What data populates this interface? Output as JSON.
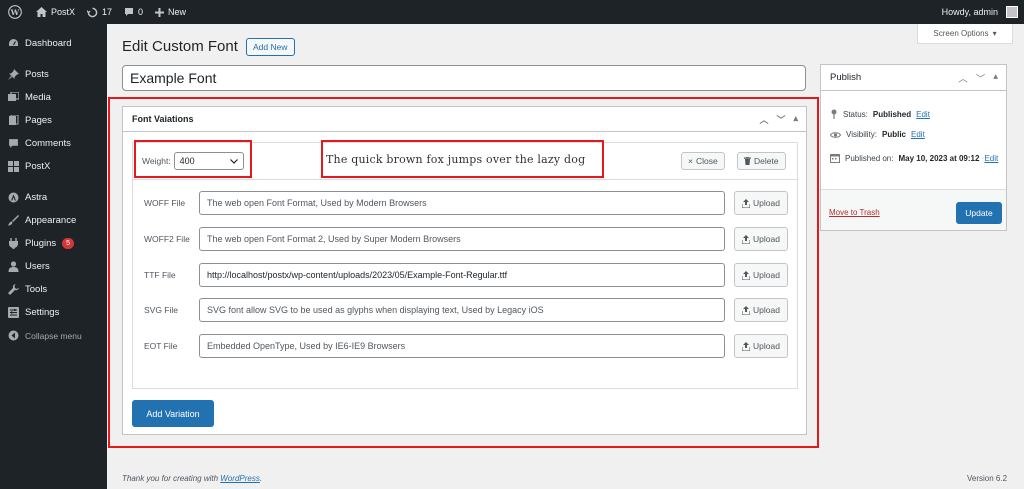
{
  "adminbar": {
    "site_name": "PostX",
    "updates_count": "17",
    "comments_count": "0",
    "new_label": "New",
    "howdy": "Howdy, admin"
  },
  "sidebar": {
    "items": [
      {
        "label": "Dashboard",
        "icon": "dashboard-icon"
      },
      {
        "label": "Posts",
        "icon": "pin-icon"
      },
      {
        "label": "Media",
        "icon": "media-icon"
      },
      {
        "label": "Pages",
        "icon": "page-icon"
      },
      {
        "label": "Comments",
        "icon": "comment-icon"
      },
      {
        "label": "PostX",
        "icon": "grid-icon"
      },
      {
        "label": "Astra",
        "icon": "astra-icon"
      },
      {
        "label": "Appearance",
        "icon": "brush-icon"
      },
      {
        "label": "Plugins",
        "icon": "plug-icon",
        "badge": "5"
      },
      {
        "label": "Users",
        "icon": "user-icon"
      },
      {
        "label": "Tools",
        "icon": "wrench-icon"
      },
      {
        "label": "Settings",
        "icon": "settings-icon"
      }
    ],
    "collapse_label": "Collapse menu"
  },
  "main": {
    "title": "Edit Custom Font",
    "add_new": "Add New",
    "screen_options": "Screen Options",
    "font_title": "Example Font"
  },
  "variations": {
    "box_title": "Font Vaiations",
    "weight_label": "Weight:",
    "weight_value": "400",
    "preview_text": "The quick brown fox jumps over the lazy dog",
    "close_label": "Close",
    "delete_label": "Delete",
    "upload_label": "Upload",
    "files": [
      {
        "label": "WOFF File",
        "value": "The web open Font Format, Used by Modern Browsers",
        "filled": false
      },
      {
        "label": "WOFF2 File",
        "value": "The web open Font Format 2, Used by Super Modern Browsers",
        "filled": false
      },
      {
        "label": "TTF File",
        "value": "http://localhost/postx/wp-content/uploads/2023/05/Example-Font-Regular.ttf",
        "filled": true
      },
      {
        "label": "SVG File",
        "value": "SVG font allow SVG to be used as glyphs when displaying text, Used by Legacy iOS",
        "filled": false
      },
      {
        "label": "EOT File",
        "value": "Embedded OpenType, Used by IE6-IE9 Browsers",
        "filled": false
      }
    ],
    "add_variation": "Add Variation"
  },
  "publish": {
    "title": "Publish",
    "status_label": "Status:",
    "status_value": "Published",
    "visibility_label": "Visibility:",
    "visibility_value": "Public",
    "published_on_label": "Published on:",
    "published_on_value": "May 10, 2023 at 09:12",
    "edit_label": "Edit",
    "trash_label": "Move to Trash",
    "update_label": "Update"
  },
  "footer": {
    "thanks_prefix": "Thank you for creating with",
    "thanks_link": "WordPress",
    "version": "Version 6.2"
  },
  "colors": {
    "adminbar_bg": "#1d2327",
    "primary": "#2271b1",
    "highlight": "#e3191e",
    "trash": "#b32d2e",
    "badge": "#d63638"
  }
}
